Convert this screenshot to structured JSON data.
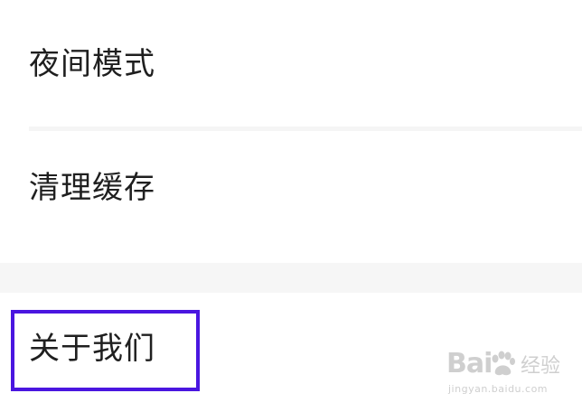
{
  "settings": {
    "items": [
      {
        "label": "夜间模式"
      },
      {
        "label": "清理缓存"
      },
      {
        "label": "关于我们"
      }
    ]
  },
  "highlight": {
    "target": "关于我们",
    "color": "#4a16e0"
  },
  "watermark": {
    "logo_text": "Bai",
    "logo_suffix": "经验",
    "url": "jingyan.baidu.com"
  },
  "colors": {
    "background": "#ffffff",
    "text": "#1f1f1f",
    "divider": "#f5f5f5",
    "section_gap": "#f6f6f6"
  }
}
